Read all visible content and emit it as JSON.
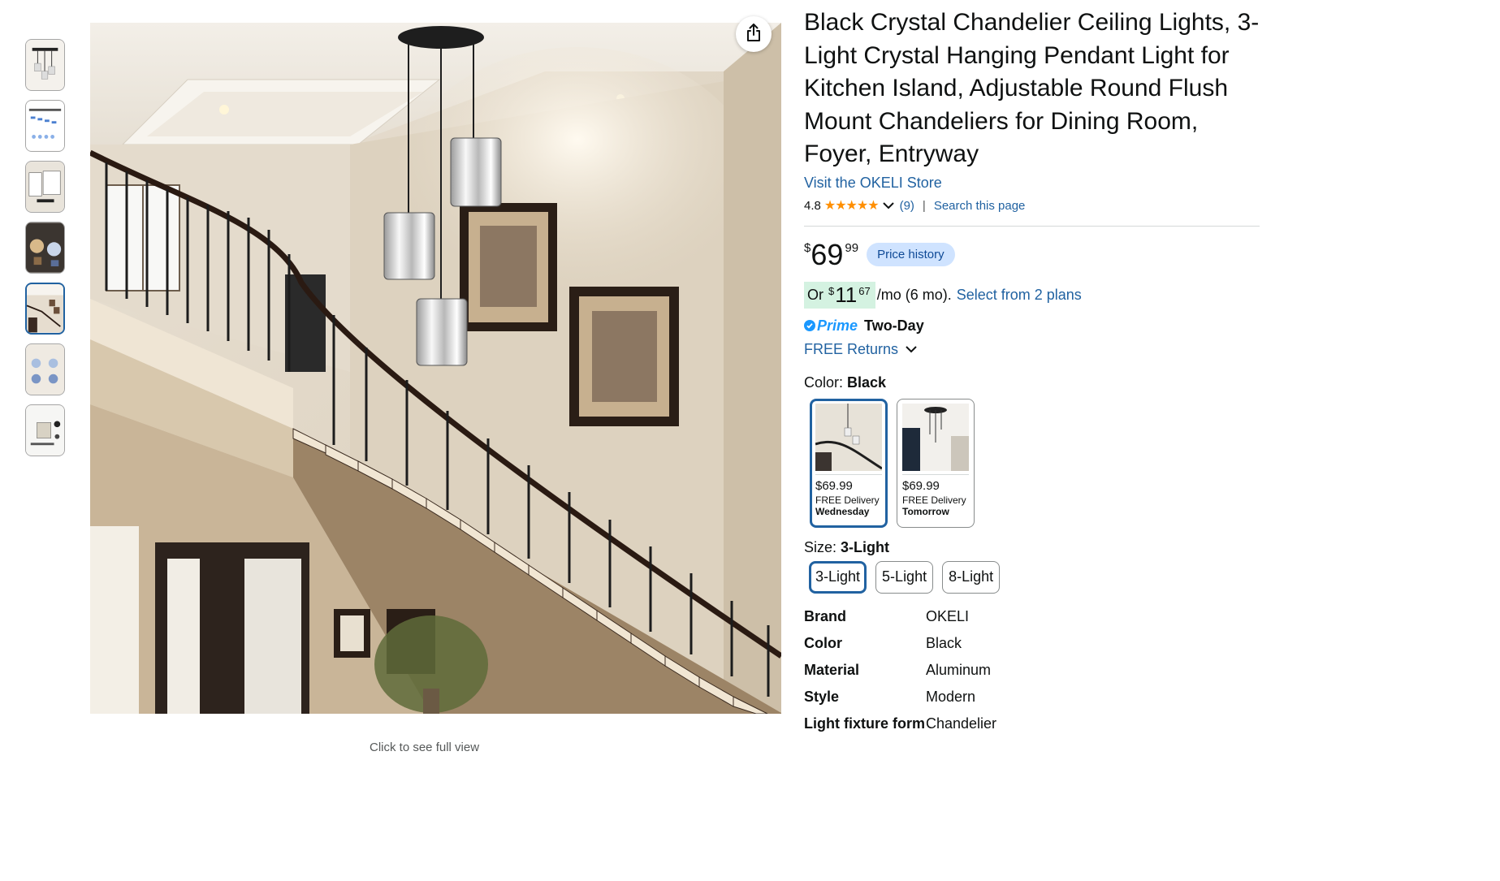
{
  "gallery": {
    "thumbnail_count": 7,
    "active_index": 4,
    "click_hint": "Click to see full view",
    "share_icon": "share-icon"
  },
  "product": {
    "title": "Black Crystal Chandelier Ceiling Lights, 3-Light Crystal Hanging Pendant Light for Kitchen Island, Adjustable Round Flush Mount Chandeliers for Dining Room, Foyer, Entryway",
    "store_link": "Visit the OKELI Store",
    "rating": "4.8",
    "stars": "★★★★★",
    "review_count": "(9)",
    "search_link": "Search this page"
  },
  "price": {
    "symbol": "$",
    "whole": "69",
    "fraction": "99",
    "history_button": "Price history"
  },
  "installment": {
    "or": "Or",
    "symbol": "$",
    "whole": "11",
    "fraction": "67",
    "per": "/mo (6 mo).",
    "link": "Select from 2 plans"
  },
  "delivery": {
    "prime": "Prime",
    "speed": "Two-Day",
    "returns": "FREE Returns"
  },
  "color": {
    "label": "Color:",
    "selected": "Black",
    "options": [
      {
        "price": "$69.99",
        "delivery": "FREE Delivery",
        "day": "Wednesday"
      },
      {
        "price": "$69.99",
        "delivery": "FREE Delivery",
        "day": "Tomorrow"
      }
    ]
  },
  "size": {
    "label": "Size:",
    "selected": "3-Light",
    "options": [
      "3-Light",
      "5-Light",
      "8-Light"
    ]
  },
  "specs": [
    {
      "key": "Brand",
      "value": "OKELI"
    },
    {
      "key": "Color",
      "value": "Black"
    },
    {
      "key": "Material",
      "value": "Aluminum"
    },
    {
      "key": "Style",
      "value": "Modern"
    },
    {
      "key": "Light fixture form",
      "value": "Chandelier"
    }
  ],
  "colors": {
    "link": "#2162a1",
    "prime": "#1a98ff",
    "star": "#ff8f00",
    "price_history_bg": "#cfe3ff",
    "installment_bg": "#d4f2e1"
  }
}
